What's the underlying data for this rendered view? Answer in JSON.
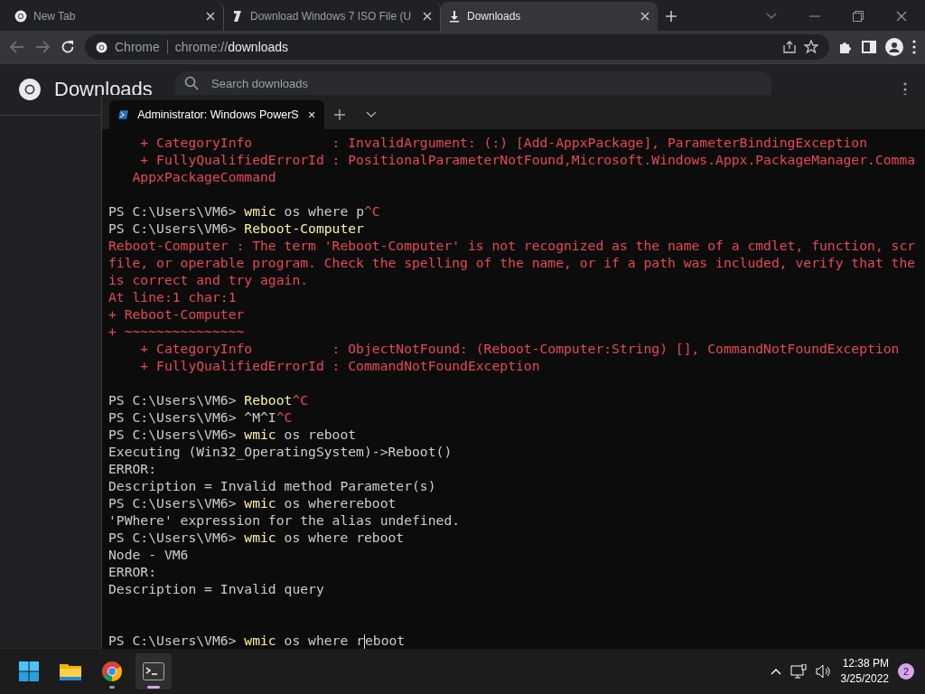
{
  "browser": {
    "tabs": [
      {
        "title": "New Tab",
        "selected": false
      },
      {
        "title": "Download Windows 7 ISO File (U",
        "selected": false
      },
      {
        "title": "Downloads",
        "selected": true
      }
    ],
    "site_label": "Chrome",
    "url": "chrome://**downloads**",
    "back_disabled": true,
    "forward_disabled": true
  },
  "page": {
    "title": "Downloads",
    "search": {
      "placeholder": "Search downloads"
    }
  },
  "terminal": {
    "tab_title": "Administrator: Windows PowerS",
    "lines": [
      {
        "kind": "text",
        "segments": [
          {
            "kind": "error",
            "text": "    + CategoryInfo          : InvalidArgument: (:) [Add-AppxPackage], ParameterBindingException"
          }
        ]
      },
      {
        "kind": "text",
        "segments": [
          {
            "kind": "error",
            "text": "    + FullyQualifiedErrorId : PositionalParameterNotFound,Microsoft.Windows.Appx.PackageManager.Comma"
          }
        ]
      },
      {
        "kind": "text",
        "segments": [
          {
            "kind": "error",
            "text": "   AppxPackageCommand"
          }
        ]
      },
      {
        "kind": "blank"
      },
      {
        "kind": "text",
        "segments": [
          {
            "kind": "plain",
            "text": "PS C:\\Users\\VM6> "
          },
          {
            "kind": "command",
            "text": "wmic"
          },
          {
            "kind": "plain",
            "text": " os where p"
          },
          {
            "kind": "error",
            "text": "^C"
          }
        ]
      },
      {
        "kind": "text",
        "segments": [
          {
            "kind": "plain",
            "text": "PS C:\\Users\\VM6> "
          },
          {
            "kind": "command",
            "text": "Reboot-Computer"
          }
        ]
      },
      {
        "kind": "text",
        "segments": [
          {
            "kind": "error",
            "text": "Reboot-Computer : The term 'Reboot-Computer' is not recognized as the name of a cmdlet, function, scr"
          }
        ]
      },
      {
        "kind": "text",
        "segments": [
          {
            "kind": "error",
            "text": "file, or operable program. Check the spelling of the name, or if a path was included, verify that the"
          }
        ]
      },
      {
        "kind": "text",
        "segments": [
          {
            "kind": "error",
            "text": "is correct and try again."
          }
        ]
      },
      {
        "kind": "text",
        "segments": [
          {
            "kind": "error",
            "text": "At line:1 char:1"
          }
        ]
      },
      {
        "kind": "text",
        "segments": [
          {
            "kind": "error",
            "text": "+ Reboot-Computer"
          }
        ]
      },
      {
        "kind": "text",
        "segments": [
          {
            "kind": "error",
            "text": "+ ~~~~~~~~~~~~~~~"
          }
        ]
      },
      {
        "kind": "text",
        "segments": [
          {
            "kind": "error",
            "text": "    + CategoryInfo          : ObjectNotFound: (Reboot-Computer:String) [], CommandNotFoundException"
          }
        ]
      },
      {
        "kind": "text",
        "segments": [
          {
            "kind": "error",
            "text": "    + FullyQualifiedErrorId : CommandNotFoundException"
          }
        ]
      },
      {
        "kind": "blank"
      },
      {
        "kind": "text",
        "segments": [
          {
            "kind": "plain",
            "text": "PS C:\\Users\\VM6> "
          },
          {
            "kind": "command",
            "text": "Reboot"
          },
          {
            "kind": "error",
            "text": "^C"
          }
        ]
      },
      {
        "kind": "text",
        "segments": [
          {
            "kind": "plain",
            "text": "PS C:\\Users\\VM6> ^M^I"
          },
          {
            "kind": "error",
            "text": "^C"
          }
        ]
      },
      {
        "kind": "text",
        "segments": [
          {
            "kind": "plain",
            "text": "PS C:\\Users\\VM6> "
          },
          {
            "kind": "command",
            "text": "wmic"
          },
          {
            "kind": "plain",
            "text": " os reboot"
          }
        ]
      },
      {
        "kind": "text",
        "segments": [
          {
            "kind": "plain",
            "text": "Executing (Win32_OperatingSystem)->Reboot()"
          }
        ]
      },
      {
        "kind": "text",
        "segments": [
          {
            "kind": "plain",
            "text": "ERROR:"
          }
        ]
      },
      {
        "kind": "text",
        "segments": [
          {
            "kind": "plain",
            "text": "Description = Invalid method Parameter(s)"
          }
        ]
      },
      {
        "kind": "text",
        "segments": [
          {
            "kind": "plain",
            "text": "PS C:\\Users\\VM6> "
          },
          {
            "kind": "command",
            "text": "wmic"
          },
          {
            "kind": "plain",
            "text": " os wherereboot"
          }
        ]
      },
      {
        "kind": "text",
        "segments": [
          {
            "kind": "plain",
            "text": "'PWhere' expression for the alias undefined."
          }
        ]
      },
      {
        "kind": "text",
        "segments": [
          {
            "kind": "plain",
            "text": "PS C:\\Users\\VM6> "
          },
          {
            "kind": "command",
            "text": "wmic"
          },
          {
            "kind": "plain",
            "text": " os where reboot"
          }
        ]
      },
      {
        "kind": "text",
        "segments": [
          {
            "kind": "plain",
            "text": "Node - VM6"
          }
        ]
      },
      {
        "kind": "text",
        "segments": [
          {
            "kind": "plain",
            "text": "ERROR:"
          }
        ]
      },
      {
        "kind": "text",
        "segments": [
          {
            "kind": "plain",
            "text": "Description = Invalid query"
          }
        ]
      },
      {
        "kind": "blank"
      },
      {
        "kind": "blank"
      },
      {
        "kind": "text",
        "segments": [
          {
            "kind": "plain",
            "text": "PS C:\\Users\\VM6> "
          },
          {
            "kind": "command",
            "text": "wmic"
          },
          {
            "kind": "plain",
            "text": " os where r"
          },
          {
            "kind": "cursor"
          },
          {
            "kind": "plain",
            "text": "eboot"
          }
        ]
      }
    ]
  },
  "taskbar": {
    "apps": [
      {
        "selected": false
      },
      {
        "selected": false
      },
      {
        "selected": false
      },
      {
        "selected": true
      }
    ],
    "time": "12:38 PM",
    "date": "3/25/2022",
    "notifications": "2"
  }
}
